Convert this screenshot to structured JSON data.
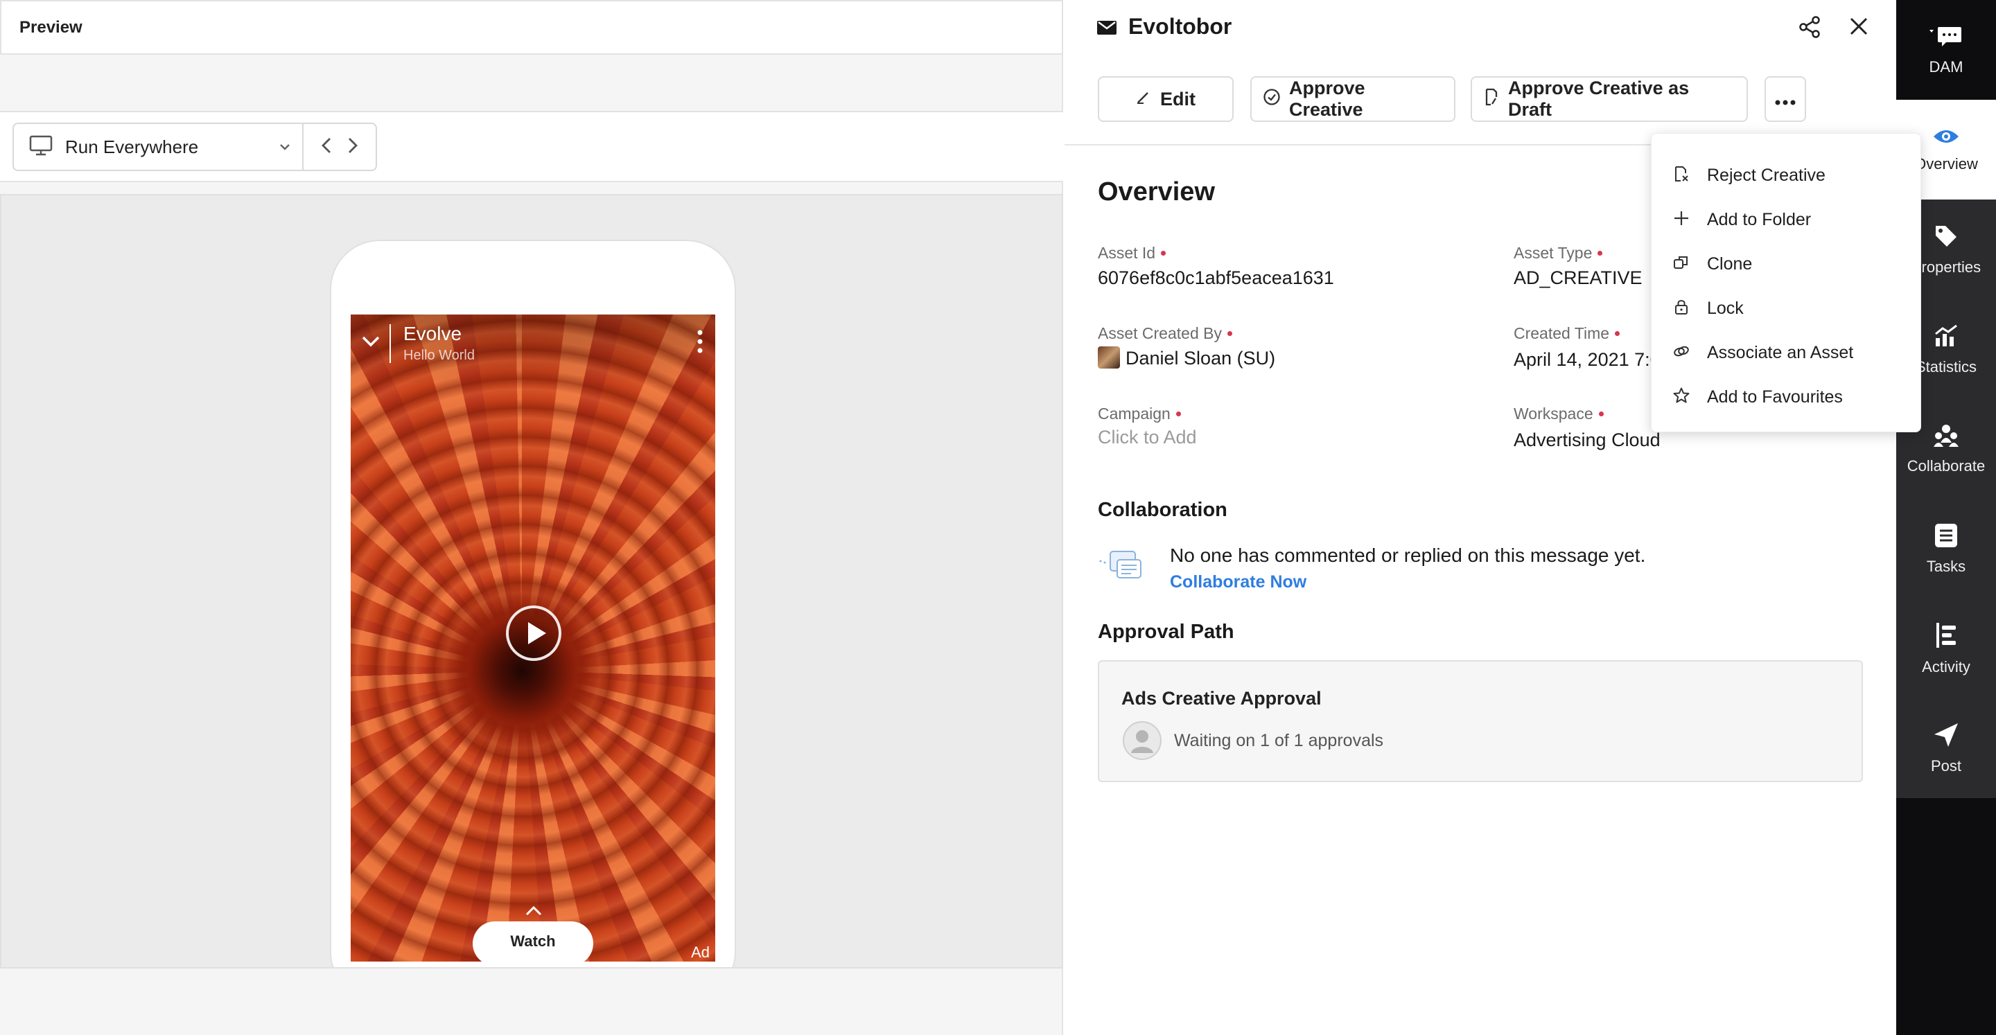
{
  "preview": {
    "title": "Preview",
    "device_select": {
      "value": "Run Everywhere"
    },
    "phone_ad": {
      "title": "Evolve",
      "subtitle": "Hello World",
      "cta": "Watch",
      "ad_label": "Ad"
    }
  },
  "detail": {
    "title": "Evoltobor",
    "actions": {
      "edit": "Edit",
      "approve": "Approve Creative",
      "approve_draft": "Approve Creative as Draft"
    },
    "overview": {
      "heading": "Overview",
      "asset_id": {
        "label": "Asset Id",
        "value": "6076ef8c0c1abf5eacea1631"
      },
      "asset_type": {
        "label": "Asset Type",
        "value": "AD_CREATIVE"
      },
      "created_by": {
        "label": "Asset Created By",
        "value": "Daniel Sloan (SU)"
      },
      "created_time": {
        "label": "Created Time",
        "value": "April 14, 2021 7:0"
      },
      "campaign": {
        "label": "Campaign",
        "value": "Click to Add"
      },
      "workspace": {
        "label": "Workspace",
        "value": "Advertising Cloud"
      }
    },
    "collaboration": {
      "heading": "Collaboration",
      "empty_text": "No one has commented or replied on this message yet.",
      "link": "Collaborate Now"
    },
    "approval": {
      "heading": "Approval Path",
      "card_title": "Ads Creative Approval",
      "status": "Waiting on 1 of 1 approvals"
    }
  },
  "menu": {
    "items": [
      {
        "label": "Reject Creative",
        "icon": "reject-icon"
      },
      {
        "label": "Add to Folder",
        "icon": "plus-icon"
      },
      {
        "label": "Clone",
        "icon": "clone-icon"
      },
      {
        "label": "Lock",
        "icon": "lock-icon"
      },
      {
        "label": "Associate an Asset",
        "icon": "link-icon"
      },
      {
        "label": "Add to Favourites",
        "icon": "star-icon"
      }
    ]
  },
  "rail": {
    "items": [
      {
        "label": "DAM",
        "icon": "chat-icon"
      },
      {
        "label": "Overview",
        "icon": "eye-icon"
      },
      {
        "label": "Properties",
        "icon": "tag-icon"
      },
      {
        "label": "Statistics",
        "icon": "chart-icon"
      },
      {
        "label": "Collaborate",
        "icon": "people-icon"
      },
      {
        "label": "Tasks",
        "icon": "list-icon"
      },
      {
        "label": "Activity",
        "icon": "activity-icon"
      },
      {
        "label": "Post",
        "icon": "send-icon"
      }
    ]
  },
  "colors": {
    "accent_blue": "#2f7de1",
    "required_dot": "#d9344f",
    "rail_bg": "#2b2b2e"
  }
}
